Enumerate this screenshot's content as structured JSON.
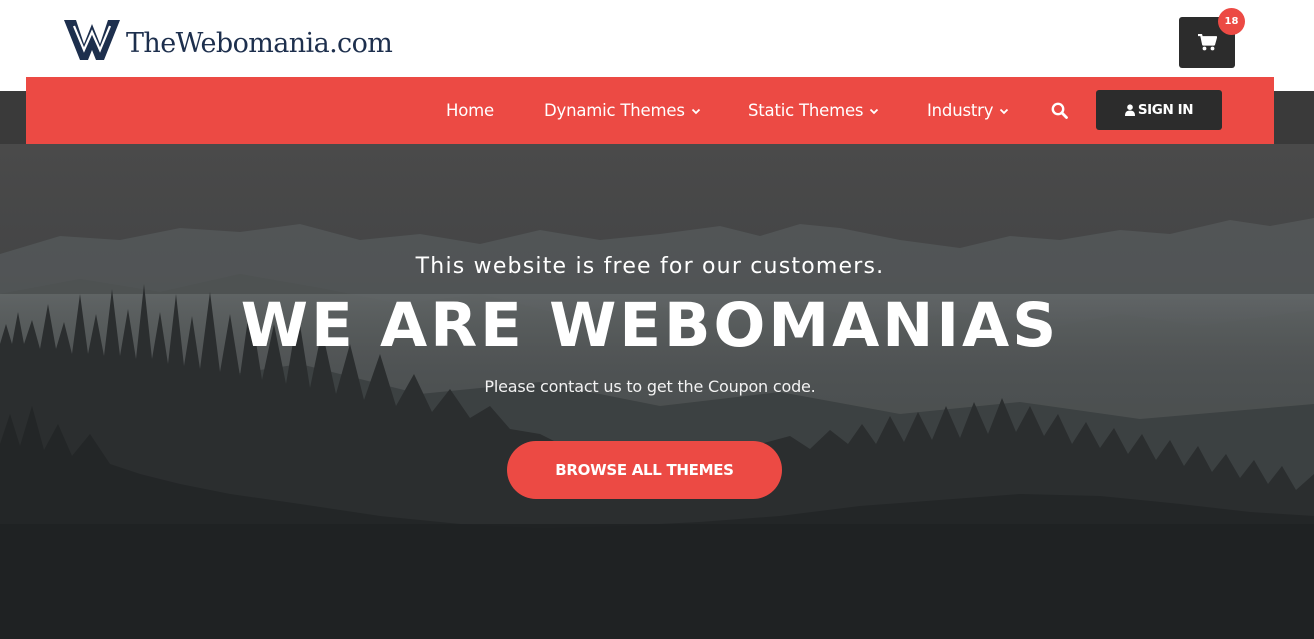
{
  "header": {
    "logo_text": "TheWebomania.com",
    "logo_icon": "w-logo-icon",
    "cart_icon": "shopping-cart-icon",
    "cart_count": "18"
  },
  "nav": {
    "items": [
      {
        "label": "Home",
        "has_dropdown": false
      },
      {
        "label": "Dynamic Themes",
        "has_dropdown": true
      },
      {
        "label": "Static Themes",
        "has_dropdown": true
      },
      {
        "label": "Industry",
        "has_dropdown": true
      }
    ],
    "search_icon": "search-icon",
    "signin_label": "SIGN IN",
    "signin_icon": "user-icon"
  },
  "hero": {
    "subtitle": "This website is free for our customers.",
    "title": "WE ARE WEBOMANIAS",
    "note": "Please contact us to get the Coupon code.",
    "cta_label": "BROWSE ALL THEMES"
  },
  "colors": {
    "accent": "#ec4a44",
    "dark_button": "#2c2c2c",
    "logo_navy": "#1d2f4d",
    "white": "#ffffff"
  }
}
